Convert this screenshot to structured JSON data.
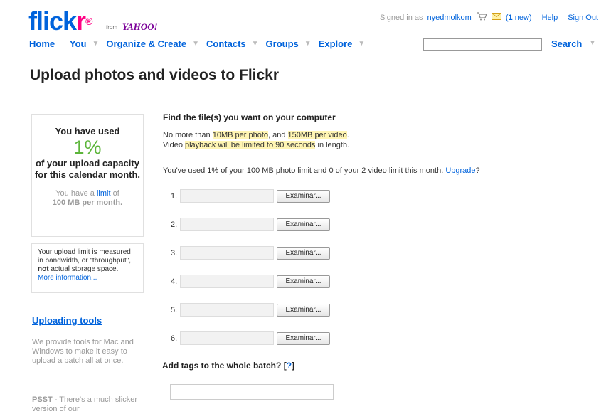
{
  "header": {
    "logo_main": "flick",
    "logo_r": "r",
    "logo_from": "from",
    "logo_yahoo": "YAHOO!",
    "signed_in_as": "Signed in as",
    "username": "nyedmolkom",
    "mail_new_count": "1",
    "mail_new_label": "new",
    "help": "Help",
    "sign_out": "Sign Out"
  },
  "nav": {
    "items": [
      "Home",
      "You",
      "Organize & Create",
      "Contacts",
      "Groups",
      "Explore"
    ],
    "search_label": "Search",
    "search_value": ""
  },
  "page_title": "Upload photos and videos to Flickr",
  "usage": {
    "line1": "You have used",
    "percent": "1%",
    "line2": "of your upload capacity for this calendar month.",
    "limit_prefix": "You have a",
    "limit_link": "limit",
    "limit_suffix": "of",
    "limit_amount": "100 MB per month."
  },
  "note": {
    "text_a": "Your upload limit is measured in bandwidth, or \"throughput\",",
    "not": "not",
    "text_b": "actual storage space.",
    "link": "More information..."
  },
  "tools": {
    "heading": "Uploading tools",
    "body": "We provide tools for Mac and Windows to make it easy to upload a batch all at once."
  },
  "psst": {
    "bold": "PSST",
    "text": " - There's a much slicker version of our"
  },
  "main": {
    "find_heading": "Find the file(s) you want on your computer",
    "limit_a": "No more than",
    "limit_photo": "10MB per photo",
    "limit_and": ", and",
    "limit_video": "150MB per video",
    "limit_dot": ".",
    "video_a": "Video",
    "video_hl": "playback will be limited to 90 seconds",
    "video_b": "in length.",
    "used_text": "You've used 1% of your 100 MB photo limit and 0 of your 2 video limit this month.",
    "upgrade": "Upgrade",
    "upgrade_q": "?",
    "file_rows": [
      {
        "num": "1.",
        "button": "Examinar..."
      },
      {
        "num": "2.",
        "button": "Examinar..."
      },
      {
        "num": "3.",
        "button": "Examinar..."
      },
      {
        "num": "4.",
        "button": "Examinar..."
      },
      {
        "num": "5.",
        "button": "Examinar..."
      },
      {
        "num": "6.",
        "button": "Examinar..."
      }
    ],
    "tags_heading": "Add tags to the whole batch?",
    "tags_help_open": "[",
    "tags_help": "?",
    "tags_help_close": "]",
    "tags_value": ""
  },
  "colors": {
    "flickr_blue": "#0063dc",
    "flickr_pink": "#ff0084",
    "usage_green": "#5cb53a",
    "highlight_yellow": "#fff5b3"
  },
  "icons": [
    "cart-icon",
    "mail-icon",
    "chevron-down-icon"
  ]
}
